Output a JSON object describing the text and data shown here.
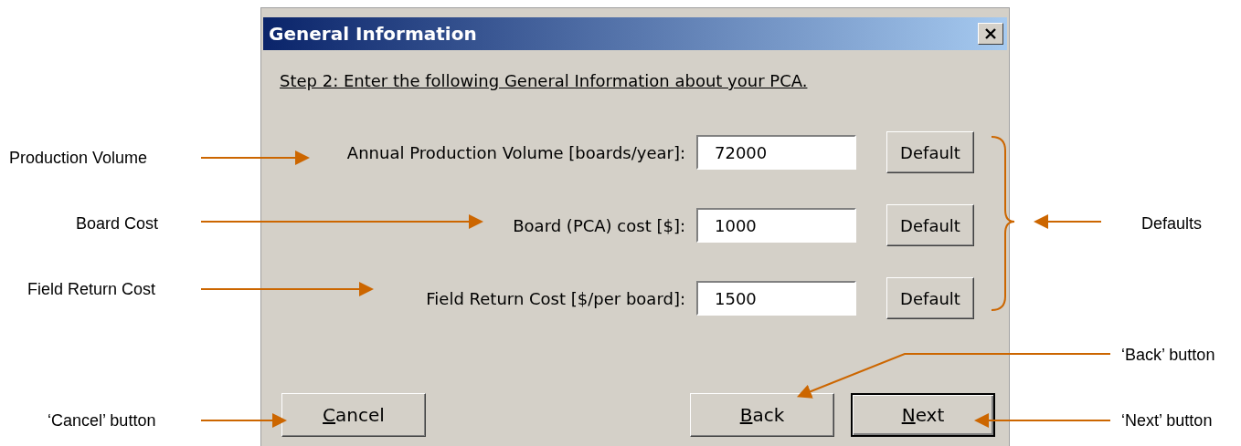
{
  "window": {
    "title": "General Information"
  },
  "instruction": "Step 2: Enter the following General Information about your PCA.",
  "fields": [
    {
      "label": "Annual Production Volume [boards/year]:",
      "value": "72000",
      "button": "Default"
    },
    {
      "label": "Board (PCA) cost [$]:",
      "value": "1000",
      "button": "Default"
    },
    {
      "label": "Field Return Cost [$/per board]:",
      "value": "1500",
      "button": "Default"
    }
  ],
  "buttons": [
    {
      "mnemonic": "C",
      "rest": "ancel",
      "default": false
    },
    {
      "mnemonic": "B",
      "rest": "ack",
      "default": false
    },
    {
      "mnemonic": "N",
      "rest": "ext",
      "default": true
    }
  ],
  "annotations": [
    {
      "text": "Production Volume"
    },
    {
      "text": "Board Cost"
    },
    {
      "text": "Field Return Cost"
    },
    {
      "text": "‘Cancel’ button"
    },
    {
      "text": "Defaults"
    },
    {
      "text": "‘Back’ button"
    },
    {
      "text": "‘Next’ button"
    }
  ]
}
